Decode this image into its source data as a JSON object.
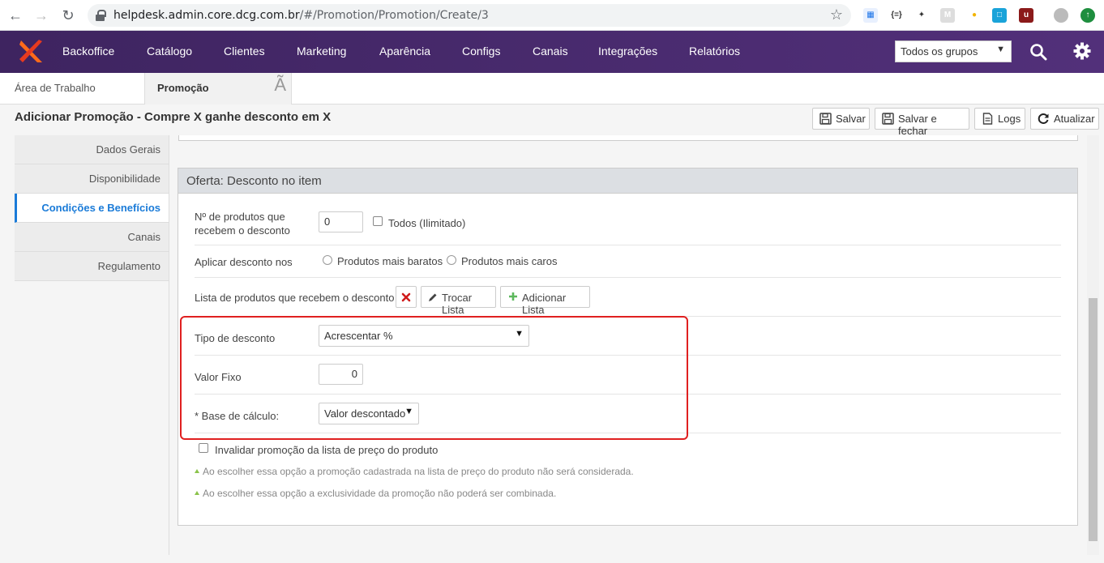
{
  "browser": {
    "url_host": "helpdesk.admin.core.dcg.com.br",
    "url_path": "/#/Promotion/Promotion/Create/3"
  },
  "topnav": {
    "menu": [
      "Backoffice",
      "Catálogo",
      "Clientes",
      "Marketing",
      "Aparência",
      "Configs",
      "Canais",
      "Integrações",
      "Relatórios"
    ],
    "group_select": "Todos os grupos",
    "accent": "#4a2a6e"
  },
  "tabs": {
    "home": "Área de Trabalho",
    "active": "Promoção",
    "close": "Ã"
  },
  "page": {
    "title": "Adicionar Promoção - Compre X ganhe desconto em X"
  },
  "toolbar": {
    "save": "Salvar",
    "save_close": "Salvar e fechar",
    "logs": "Logs",
    "refresh": "Atualizar"
  },
  "sidebar": {
    "items": [
      "Dados Gerais",
      "Disponibilidade",
      "Condições e Benefícios",
      "Canais",
      "Regulamento"
    ],
    "active_color": "#1a7bd8"
  },
  "offer": {
    "title": "Oferta: Desconto no item",
    "qty_label_1": "Nº de produtos que",
    "qty_label_2": "recebem o desconto",
    "qty_value": "0",
    "unlimited_label": "Todos (Ilimitado)",
    "apply_label": "Aplicar desconto nos",
    "apply_option_cheaper": "Produtos mais baratos",
    "apply_option_expensive": "Produtos mais caros",
    "list_label": "Lista de produtos que recebem o desconto",
    "btn_swap": "Trocar Lista",
    "btn_add": "Adicionar Lista",
    "discount_type_label": "Tipo de desconto",
    "discount_type_value": "Acrescentar %",
    "fixed_value_label": "Valor Fixo",
    "fixed_value": "0",
    "calc_base_label": "* Base de cálculo:",
    "calc_base_value": "Valor descontado",
    "invalidate_label": "Invalidar promoção da lista de preço do produto",
    "note_1": "Ao escolher essa opção a promoção cadastrada na lista de preço do produto não será considerada.",
    "note_2": "Ao escolher essa opção a exclusividade da promoção não poderá ser combinada."
  }
}
